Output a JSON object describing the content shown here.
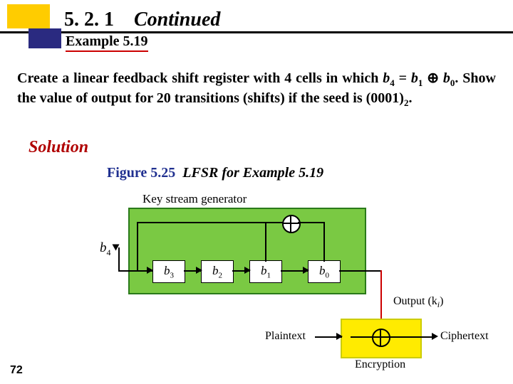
{
  "header": {
    "section_number": "5. 2. 1",
    "section_title": "Continued",
    "example_label": "Example 5.19"
  },
  "problem": {
    "prefix": "Create a linear feedback shift register with 4 cells in which ",
    "eq_b4": "b",
    "eq_b4_sub": "4",
    "eq_eq": " = ",
    "eq_b1": "b",
    "eq_b1_sub": "1",
    "eq_xor": " ⊕ ",
    "eq_b0": "b",
    "eq_b0_sub": "0",
    "middle": ". Show the value of output for 20 transitions (shifts) if the seed is (0001)",
    "seed_sub": "2",
    "end": "."
  },
  "solution_label": "Solution",
  "figure": {
    "label": "Figure 5.25",
    "title": "LFSR for Example 5.19",
    "ksg": "Key stream generator",
    "b4": "b",
    "b4s": "4",
    "cells": {
      "b3": "b",
      "b3s": "3",
      "b2": "b",
      "b2s": "2",
      "b1": "b",
      "b1s": "1",
      "b0": "b",
      "b0s": "0"
    },
    "output": "Output (k",
    "output_i": "i",
    "output_end": ")",
    "plaintext": "Plaintext",
    "ciphertext": "Ciphertext",
    "encryption": "Encryption"
  },
  "page": "72"
}
